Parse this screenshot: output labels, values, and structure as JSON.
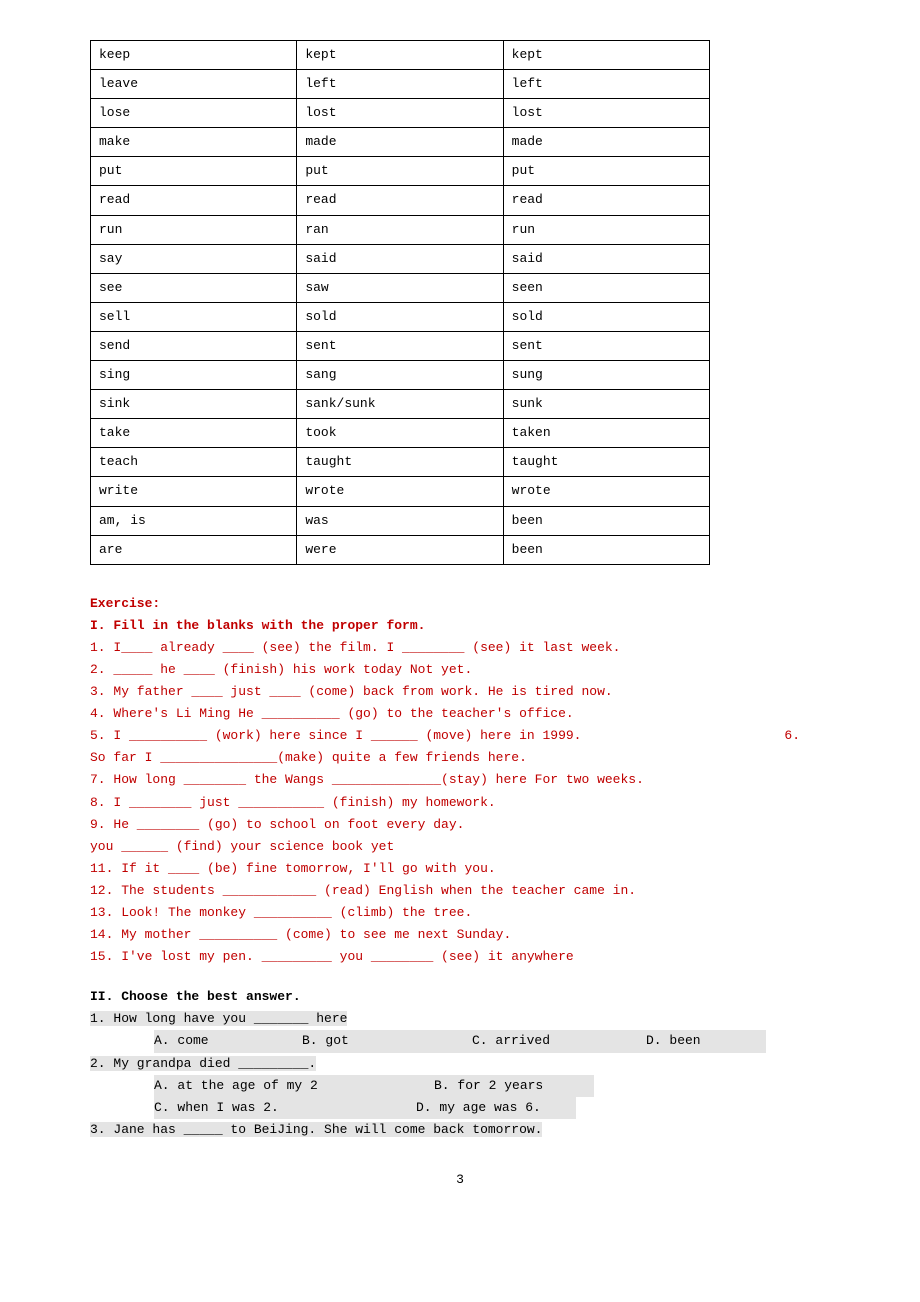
{
  "verb_table": [
    [
      "keep",
      "kept",
      "kept"
    ],
    [
      "leave",
      "left",
      "left"
    ],
    [
      "lose",
      "lost",
      "lost"
    ],
    [
      "make",
      "made",
      "made"
    ],
    [
      "put",
      "put",
      "put"
    ],
    [
      "read",
      "read",
      "read"
    ],
    [
      "run",
      "ran",
      "run"
    ],
    [
      "say",
      "said",
      "said"
    ],
    [
      "see",
      "saw",
      "seen"
    ],
    [
      "sell",
      "sold",
      "sold"
    ],
    [
      "send",
      "sent",
      "sent"
    ],
    [
      "sing",
      "sang",
      "sung"
    ],
    [
      "sink",
      "sank/sunk",
      "sunk"
    ],
    [
      "take",
      "took",
      "taken"
    ],
    [
      "teach",
      "taught",
      "taught"
    ],
    [
      "write",
      "wrote",
      "wrote"
    ],
    [
      "am, is",
      "was",
      "been"
    ],
    [
      "are",
      "were",
      "been"
    ]
  ],
  "ex_title": "Exercise:",
  "s1_title": "I. Fill in the blanks with the proper form.",
  "s1": {
    "q1": "1. I____ already ____ (see) the film. I ________ (see) it last week.",
    "q2": "2. _____ he ____ (finish) his work today Not yet.",
    "q3": "3. My father ____ just ____ (come) back from work. He is tired now.",
    "q4": "4. Where's Li Ming  He __________ (go) to the teacher's office.",
    "q5a": "5. I __________ (work) here since I ______ (move) here in 1999.",
    "q5b": "6.",
    "q6": "So far I _______________(make) quite a few friends here.",
    "q7": "7. How long ________ the Wangs ______________(stay) here  For two weeks.",
    "q8": "8. I ________ just ___________ (finish) my homework.",
    "q9": "9. He ________ (go) to school on foot every day.",
    "q10": "you ______ (find) your science book yet",
    "q11": "11. If it ____ (be) fine tomorrow, I'll go with you.",
    "q12": "12. The students ____________ (read) English when the teacher came in.",
    "q13": "13. Look! The monkey __________ (climb) the tree.",
    "q14": "14. My mother __________ (come) to see me next Sunday.",
    "q15": "15. I've lost my pen. _________ you ________ (see) it anywhere"
  },
  "s2_title": "II. Choose the best answer.",
  "s2": {
    "q1": "1. How long have you _______ here",
    "q1a": "A. come",
    "q1b": "B. got",
    "q1c": "C. arrived",
    "q1d": "D. been",
    "q2": "2. My grandpa died _________.",
    "q2a": "A. at the age of my 2",
    "q2b": "B. for 2 years",
    "q2c": "C. when I was 2.",
    "q2d": "D. my age was 6.",
    "q3": "3. Jane has _____ to BeiJing. She will come back tomorrow."
  },
  "page_number": "3"
}
